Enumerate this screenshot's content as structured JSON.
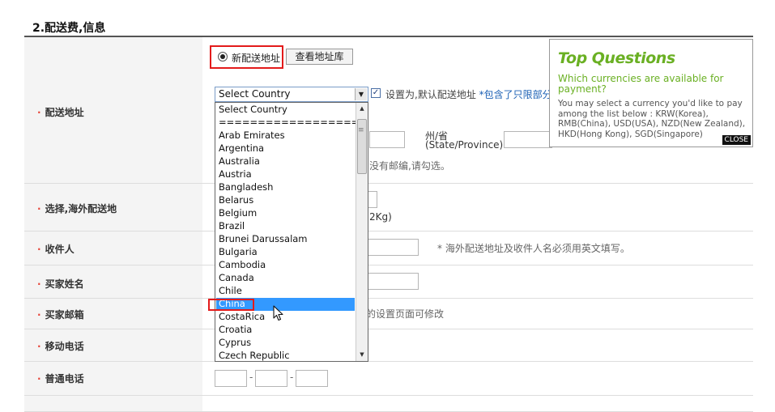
{
  "section_title": "2.配送费,信息",
  "radio_new_address": "新配送地址",
  "view_address_book_button": "查看地址库",
  "labels": {
    "shipping_address": "配送地址",
    "choose_overseas": "选择,海外配送地",
    "recipient": "收件人",
    "buyer_name": "买家姓名",
    "buyer_email": "买家邮箱",
    "mobile": "移动电话",
    "phone": "普通电话"
  },
  "country_select": {
    "value": "Select Country"
  },
  "default_address_text": "设置为,默认配送地址",
  "default_address_link": "*包含了只限部分国",
  "state_label": "州/省",
  "state_sub": "(State/Province)",
  "no_zip_note": "没有邮编,请勾选。",
  "weight_note": "2Kg)",
  "recipient_note": "* 海外配送地址及收件人名必须用英文填写。",
  "email_note": "我的设置页面可修改",
  "phone_separators": [
    "-",
    "-"
  ],
  "dropdown_options": [
    "Select Country",
    "==================",
    "Arab Emirates",
    "Argentina",
    "Australia",
    "Austria",
    "Bangladesh",
    "Belarus",
    "Belgium",
    "Brazil",
    "Brunei Darussalam",
    "Bulgaria",
    "Cambodia",
    "Canada",
    "Chile",
    "China",
    "CostaRica",
    "Croatia",
    "Cyprus",
    "Czech Republic"
  ],
  "dropdown_selected": "China",
  "popup": {
    "title": "Top Questions",
    "question": "Which currencies are available for payment?",
    "answer": "You may select a currency you'd like to pay among the list below : KRW(Korea), RMB(China), USD(USA), NZD(New Zealand), HKD(Hong Kong), SGD(Singapore)",
    "close": "CLOSE"
  },
  "colors": {
    "accent_red": "#e31b1b",
    "popup_green": "#6ab023",
    "selected_blue": "#3399ff",
    "bullet": "#e6453a"
  },
  "icons": [
    "radio-selected-icon",
    "dropdown-arrow-icon",
    "checkbox-checked-icon",
    "scroll-up-icon",
    "scroll-down-icon",
    "mouse-pointer-icon"
  ]
}
